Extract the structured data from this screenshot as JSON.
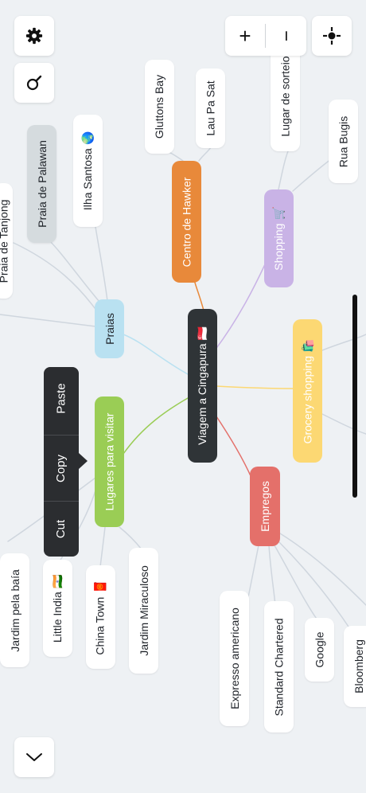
{
  "central": {
    "label": "Viagem a Cingapura 🇸🇬"
  },
  "categories": {
    "praias": {
      "label": "Praias",
      "color": "#b9e1f1"
    },
    "lugares": {
      "label": "Lugares para visitar",
      "color": "#9acd55"
    },
    "hawker": {
      "label": "Centro de Hawker",
      "color": "#e8893a"
    },
    "shopping": {
      "label": "Shopping 🛒",
      "color": "#c9b3e6"
    },
    "grocery": {
      "label": "Grocery shopping 🛍️",
      "color": "#fcd873"
    },
    "empregos": {
      "label": "Empregos",
      "color": "#e4706a"
    }
  },
  "leaves": {
    "tanjong": "Praia de Tanjong",
    "palawan": "Praia de Palawan",
    "sentosa": "Ilha Santosa 🌏",
    "gluttons": "Gluttons Bay",
    "laupasat": "Lau Pa Sat",
    "sorteio": "Lugar de sorteio",
    "bugis": "Rua Bugis",
    "baia": "Jardim pela baía",
    "india": "Little India 🇮🇳",
    "chinatown": "China Town 🧧",
    "miraculoso": "Jardim Miraculoso",
    "expresso": "Expresso americano",
    "chartered": "Standard Chartered",
    "google": "Google",
    "bloomberg": "Bloomberg"
  },
  "context_menu": {
    "cut": "Cut",
    "copy": "Copy",
    "paste": "Paste"
  },
  "toolbar": {
    "settings_icon": "gear-icon",
    "search_icon": "search-icon",
    "zoom_in": "+",
    "zoom_out": "−",
    "recenter_icon": "crosshair-icon",
    "collapse_icon": "chevron-down-icon"
  }
}
